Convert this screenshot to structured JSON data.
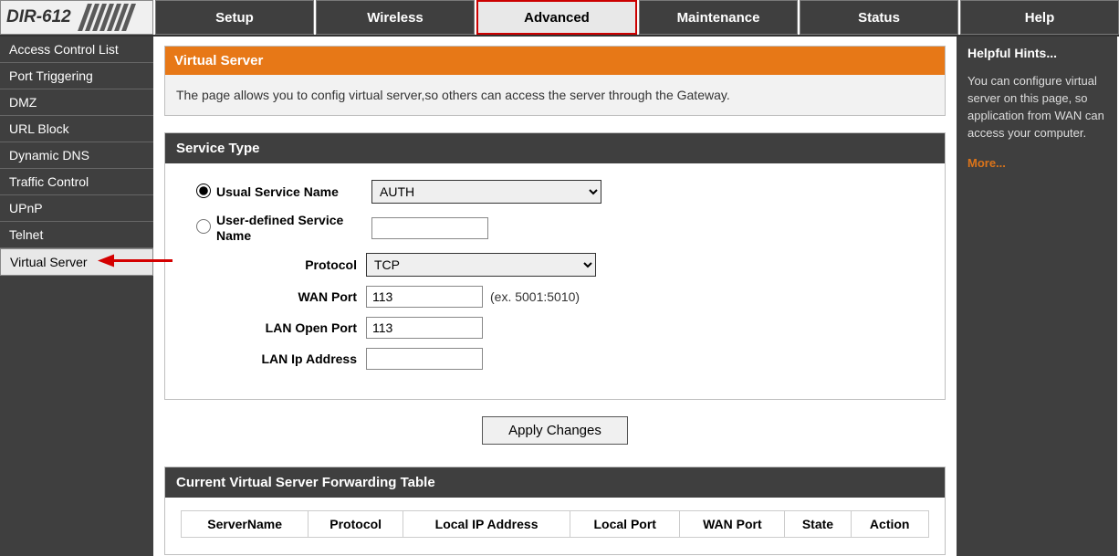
{
  "logo": "DIR-612",
  "nav": {
    "tabs": [
      {
        "label": "Setup"
      },
      {
        "label": "Wireless"
      },
      {
        "label": "Advanced"
      },
      {
        "label": "Maintenance"
      },
      {
        "label": "Status"
      },
      {
        "label": "Help"
      }
    ],
    "active_index": 2
  },
  "sidebar": {
    "items": [
      {
        "label": "Access Control List"
      },
      {
        "label": "Port Triggering"
      },
      {
        "label": "DMZ"
      },
      {
        "label": "URL Block"
      },
      {
        "label": "Dynamic DNS"
      },
      {
        "label": "Traffic Control"
      },
      {
        "label": "UPnP"
      },
      {
        "label": "Telnet"
      },
      {
        "label": "Virtual Server"
      }
    ],
    "selected_index": 8
  },
  "page": {
    "title": "Virtual Server",
    "description": "The page allows you to config virtual server,so others can access the server through the Gateway."
  },
  "service_type": {
    "header": "Service Type",
    "usual_label": "Usual Service Name",
    "usual_selected": "AUTH",
    "user_defined_label": "User-defined Service Name",
    "user_defined_value": "",
    "protocol_label": "Protocol",
    "protocol_selected": "TCP",
    "wan_port_label": "WAN Port",
    "wan_port_value": "113",
    "wan_port_hint": "(ex. 5001:5010)",
    "lan_open_port_label": "LAN Open Port",
    "lan_open_port_value": "113",
    "lan_ip_label": "LAN Ip Address",
    "lan_ip_value": "",
    "radio_selected": "usual"
  },
  "buttons": {
    "apply": "Apply Changes"
  },
  "forwarding_table": {
    "header": "Current Virtual Server Forwarding Table",
    "columns": [
      "ServerName",
      "Protocol",
      "Local IP Address",
      "Local Port",
      "WAN Port",
      "State",
      "Action"
    ]
  },
  "hints": {
    "title": "Helpful Hints...",
    "body": "You can configure virtual server on this page, so application from WAN can access your computer.",
    "more": "More..."
  }
}
